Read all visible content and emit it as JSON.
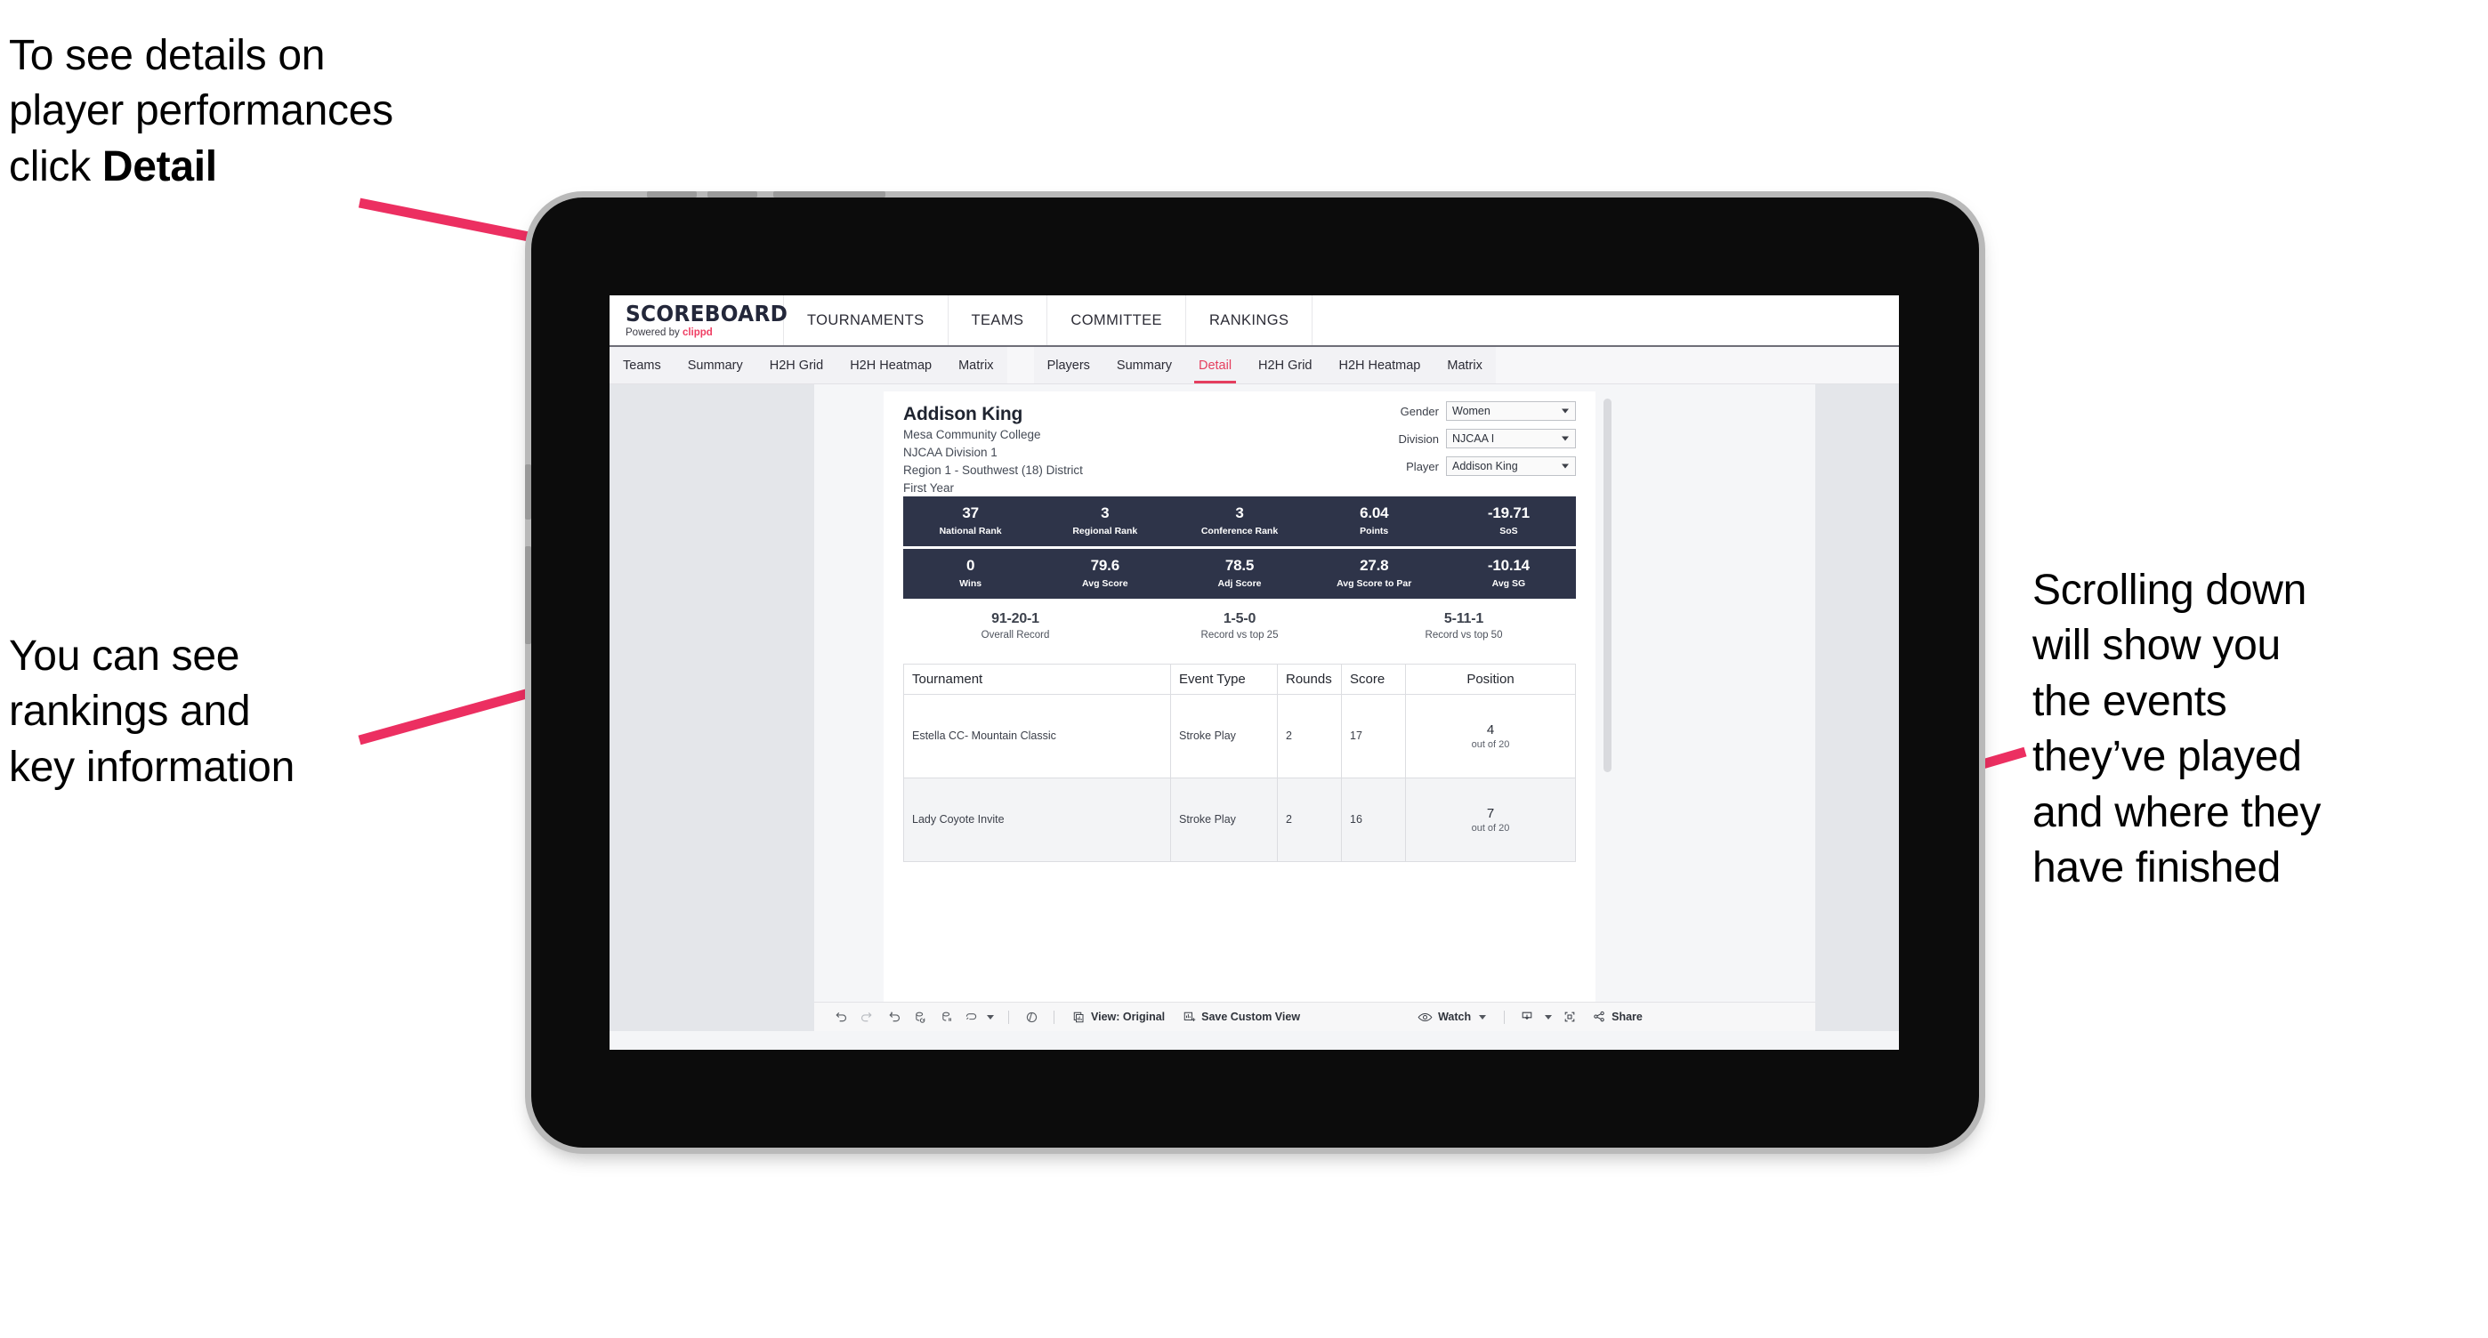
{
  "annotations": {
    "top_left": "To see details on\nplayer performances\nclick ",
    "top_left_bold": "Detail",
    "mid_left": "You can see\nrankings and\nkey information",
    "right": "Scrolling down\nwill show you\nthe events\nthey’ve played\nand where they\nhave finished",
    "arrow_color": "#ec2f61"
  },
  "app": {
    "logo_main": "SCOREBOARD",
    "logo_sub_prefix": "Powered by ",
    "logo_brand": "clippd",
    "brand_color": "#ef3e63",
    "top_nav": [
      {
        "label": "TOURNAMENTS"
      },
      {
        "label": "TEAMS"
      },
      {
        "label": "COMMITTEE"
      },
      {
        "label": "RANKINGS"
      }
    ],
    "sub_nav_left": [
      {
        "label": "Teams",
        "active": false
      },
      {
        "label": "Summary",
        "active": false
      },
      {
        "label": "H2H Grid",
        "active": false
      },
      {
        "label": "H2H Heatmap",
        "active": false
      },
      {
        "label": "Matrix",
        "active": false
      }
    ],
    "sub_nav_right": [
      {
        "label": "Players",
        "active": false
      },
      {
        "label": "Summary",
        "active": false
      },
      {
        "label": "Detail",
        "active": true
      },
      {
        "label": "H2H Grid",
        "active": false
      },
      {
        "label": "H2H Heatmap",
        "active": false
      },
      {
        "label": "Matrix",
        "active": false
      }
    ]
  },
  "player": {
    "name": "Addison King",
    "school": "Mesa Community College",
    "division": "NJCAA Division 1",
    "region": "Region 1 - Southwest (18) District",
    "year": "First Year"
  },
  "filters": [
    {
      "label": "Gender",
      "value": "Women"
    },
    {
      "label": "Division",
      "value": "NJCAA I"
    },
    {
      "label": "Player",
      "value": "Addison King"
    }
  ],
  "stats_row_1": [
    {
      "value": "37",
      "label": "National Rank"
    },
    {
      "value": "3",
      "label": "Regional Rank"
    },
    {
      "value": "3",
      "label": "Conference Rank"
    },
    {
      "value": "6.04",
      "label": "Points"
    },
    {
      "value": "-19.71",
      "label": "SoS"
    }
  ],
  "stats_row_2": [
    {
      "value": "0",
      "label": "Wins"
    },
    {
      "value": "79.6",
      "label": "Avg Score"
    },
    {
      "value": "78.5",
      "label": "Adj Score"
    },
    {
      "value": "27.8",
      "label": "Avg Score to Par"
    },
    {
      "value": "-10.14",
      "label": "Avg SG"
    }
  ],
  "records": [
    {
      "value": "91-20-1",
      "label": "Overall Record"
    },
    {
      "value": "1-5-0",
      "label": "Record vs top 25"
    },
    {
      "value": "5-11-1",
      "label": "Record vs top 50"
    }
  ],
  "events_table": {
    "columns": [
      "Tournament",
      "Event Type",
      "Rounds",
      "Score",
      "Position"
    ],
    "rows": [
      {
        "tournament": "Estella CC- Mountain Classic",
        "event_type": "Stroke Play",
        "rounds": "2",
        "score": "17",
        "position": "4",
        "position_sub": "out of 20"
      },
      {
        "tournament": "Lady Coyote Invite",
        "event_type": "Stroke Play",
        "rounds": "2",
        "score": "16",
        "position": "7",
        "position_sub": "out of 20"
      }
    ]
  },
  "toolbar": {
    "view_label": "View: Original",
    "save_label": "Save Custom View",
    "watch_label": "Watch",
    "share_label": "Share"
  },
  "theme": {
    "stat_bar_bg": "#2e3449",
    "accent": "#e53e5e"
  }
}
